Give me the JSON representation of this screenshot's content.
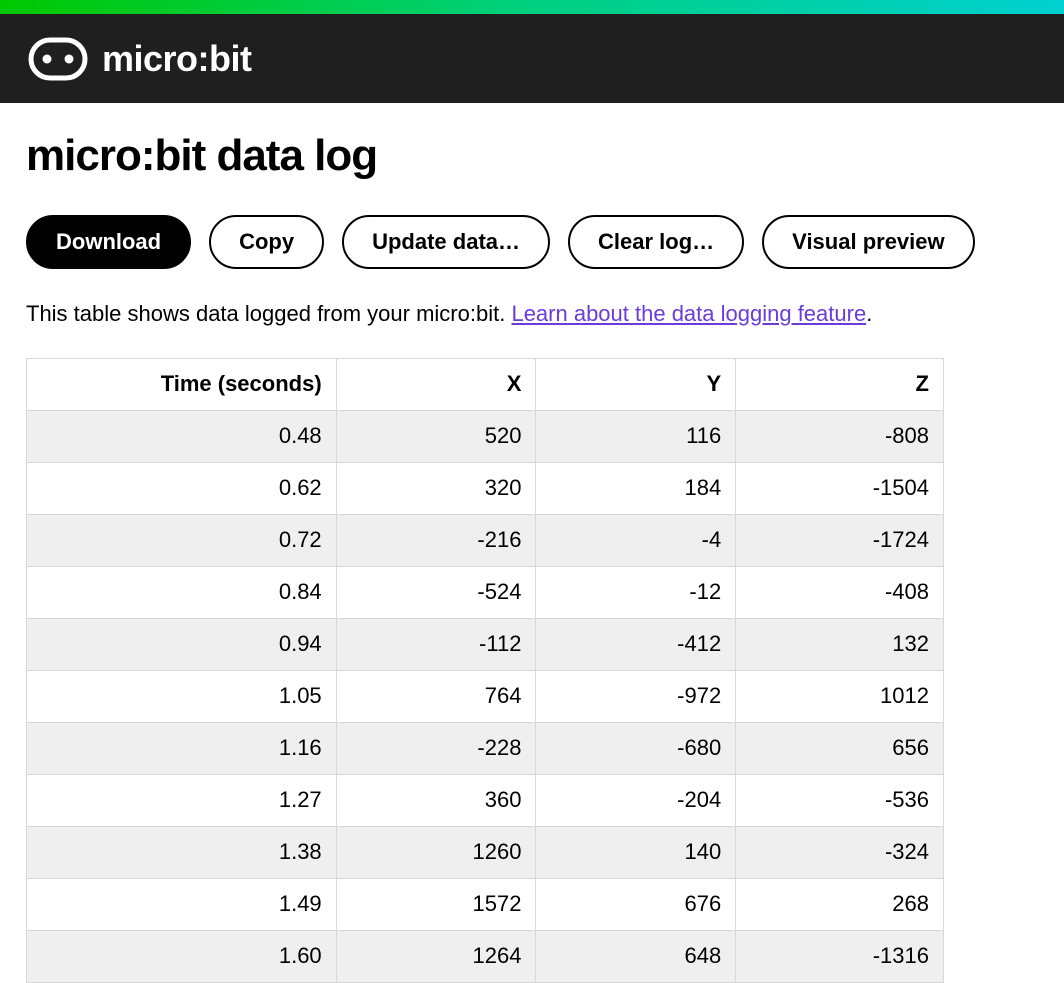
{
  "header": {
    "logo_text": "micro:bit"
  },
  "page": {
    "title": "micro:bit data log"
  },
  "toolbar": {
    "download": "Download",
    "copy": "Copy",
    "update": "Update data…",
    "clear": "Clear log…",
    "preview": "Visual preview"
  },
  "intro": {
    "text_before": "This table shows data logged from your micro:bit. ",
    "link_text": "Learn about the data logging feature",
    "text_after": "."
  },
  "table": {
    "headers": [
      "Time (seconds)",
      "X",
      "Y",
      "Z"
    ],
    "rows": [
      [
        "0.48",
        "520",
        "116",
        "-808"
      ],
      [
        "0.62",
        "320",
        "184",
        "-1504"
      ],
      [
        "0.72",
        "-216",
        "-4",
        "-1724"
      ],
      [
        "0.84",
        "-524",
        "-12",
        "-408"
      ],
      [
        "0.94",
        "-112",
        "-412",
        "132"
      ],
      [
        "1.05",
        "764",
        "-972",
        "1012"
      ],
      [
        "1.16",
        "-228",
        "-680",
        "656"
      ],
      [
        "1.27",
        "360",
        "-204",
        "-536"
      ],
      [
        "1.38",
        "1260",
        "140",
        "-324"
      ],
      [
        "1.49",
        "1572",
        "676",
        "268"
      ],
      [
        "1.60",
        "1264",
        "648",
        "-1316"
      ]
    ]
  }
}
